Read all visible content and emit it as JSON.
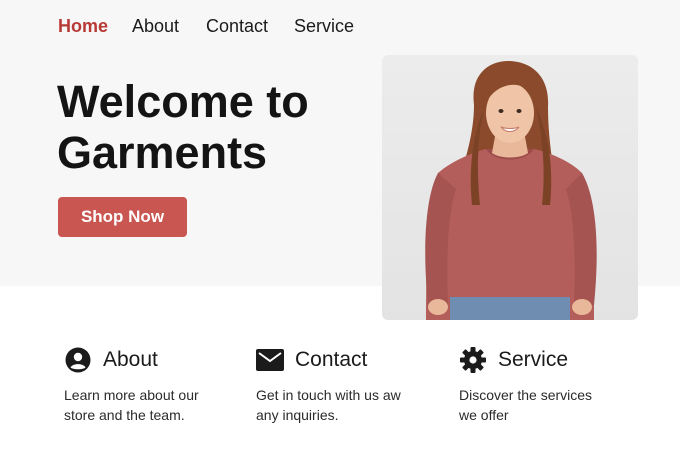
{
  "nav": {
    "items": [
      {
        "label": "Home",
        "active": true
      },
      {
        "label": "About",
        "active": false
      },
      {
        "label": "Contact",
        "active": false
      },
      {
        "label": "Service",
        "active": false
      }
    ]
  },
  "hero": {
    "title": "Welcome to Garments",
    "cta_label": "Shop Now"
  },
  "features": [
    {
      "icon": "user-circle-icon",
      "title": "About",
      "desc": "Learn more about our store and the team."
    },
    {
      "icon": "envelope-icon",
      "title": "Contact",
      "desc": "Get in touch with us aw any inquiries."
    },
    {
      "icon": "gear-icon",
      "title": "Service",
      "desc": "Discover the services we offer"
    }
  ],
  "colors": {
    "accent": "#b73a36",
    "button": "#c95651",
    "hero_bg": "#f7f7f7",
    "text": "#1b1b1b"
  }
}
